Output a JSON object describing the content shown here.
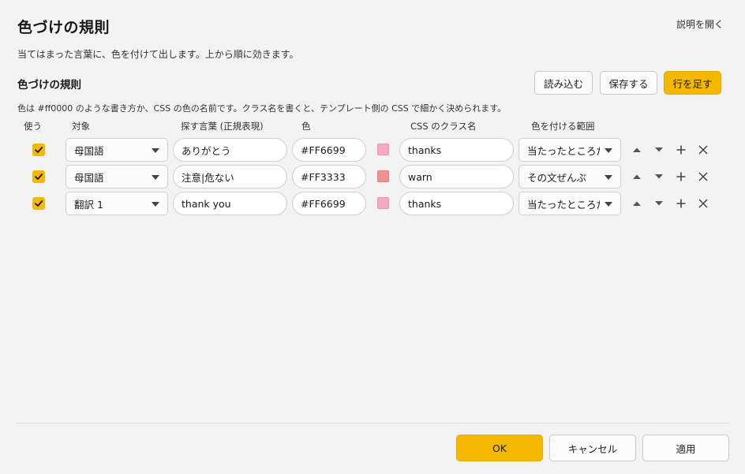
{
  "dialog": {
    "title": "色づけの規則",
    "help_link": "説明を開く",
    "description": "当てはまった言葉に、色を付けて出します。上から順に効きます。"
  },
  "section": {
    "title": "色づけの規則",
    "load_label": "読み込む",
    "save_label": "保存する",
    "add_row_label": "行を足す",
    "hint": "色は #ff0000 のような書き方か、CSS の色の名前です。クラス名を書くと、テンプレート側の CSS で細かく決められます。"
  },
  "columns": {
    "use": "使う",
    "target": "対象",
    "pattern": "探す言葉 (正規表現)",
    "color": "色",
    "css_class": "CSS のクラス名",
    "scope": "色を付ける範囲"
  },
  "rows": [
    {
      "enabled": true,
      "target": "母国語",
      "pattern": "ありがとう",
      "color": "#FF6699",
      "swatch": "#f5a8c2",
      "css_class": "thanks",
      "scope": "当たったところだけ"
    },
    {
      "enabled": true,
      "target": "母国語",
      "pattern": "注意|危ない",
      "color": "#FF3333",
      "swatch": "#f29090",
      "css_class": "warn",
      "scope": "その文ぜんぶ"
    },
    {
      "enabled": true,
      "target": "翻訳 1",
      "pattern": "thank you",
      "color": "#FF6699",
      "swatch": "#f5a8c2",
      "css_class": "thanks",
      "scope": "当たったところだけ"
    }
  ],
  "footer": {
    "ok_label": "OK",
    "cancel_label": "キャンセル",
    "apply_label": "適用"
  },
  "colors": {
    "accent": "#f5b800",
    "background": "#f3f3f3"
  }
}
